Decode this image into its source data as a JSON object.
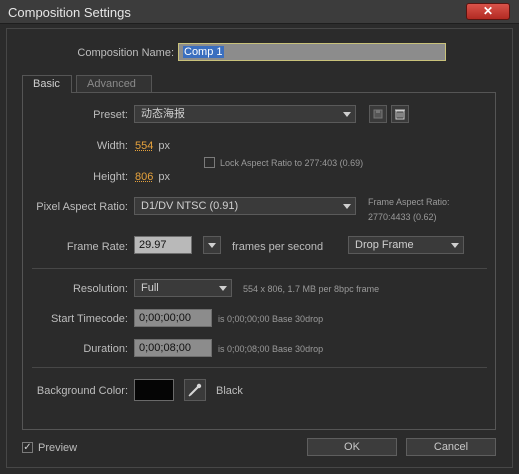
{
  "window": {
    "title": "Composition Settings",
    "close_glyph": "✕"
  },
  "composition_name": {
    "label": "Composition Name:",
    "value": "Comp 1"
  },
  "tabs": [
    {
      "label": "Basic"
    },
    {
      "label": "Advanced"
    }
  ],
  "preset": {
    "label": "Preset:",
    "value": "动态海报"
  },
  "width": {
    "label": "Width:",
    "value": "554",
    "unit": "px"
  },
  "height": {
    "label": "Height:",
    "value": "806",
    "unit": "px"
  },
  "lock_aspect": {
    "label": "Lock Aspect Ratio to 277:403 (0.69)",
    "checked": false
  },
  "pixel_aspect": {
    "label": "Pixel Aspect Ratio:",
    "value": "D1/DV NTSC (0.91)"
  },
  "frame_aspect": {
    "line1": "Frame Aspect Ratio:",
    "line2": "2770:4433 (0.62)"
  },
  "frame_rate": {
    "label": "Frame Rate:",
    "value": "29.97",
    "suffix": "frames per second",
    "drop_frame": "Drop Frame"
  },
  "resolution": {
    "label": "Resolution:",
    "value": "Full",
    "info": "554 x 806, 1.7 MB per 8bpc frame"
  },
  "start_timecode": {
    "label": "Start Timecode:",
    "value": "0;00;00;00",
    "info": "is 0;00;00;00  Base 30drop"
  },
  "duration": {
    "label": "Duration:",
    "value": "0;00;08;00",
    "info": "is 0;00;08;00  Base 30drop"
  },
  "background_color": {
    "label": "Background Color:",
    "color": "#050505",
    "name": "Black"
  },
  "preview": {
    "label": "Preview",
    "checked": true
  },
  "buttons": {
    "ok": "OK",
    "cancel": "Cancel"
  },
  "icons": {
    "save_preset": "save-icon",
    "delete_preset": "trash-icon",
    "eyedropper": "eyedropper-icon"
  },
  "colors": {
    "link": "#e6a23c",
    "selection": "#3b6fbf"
  }
}
